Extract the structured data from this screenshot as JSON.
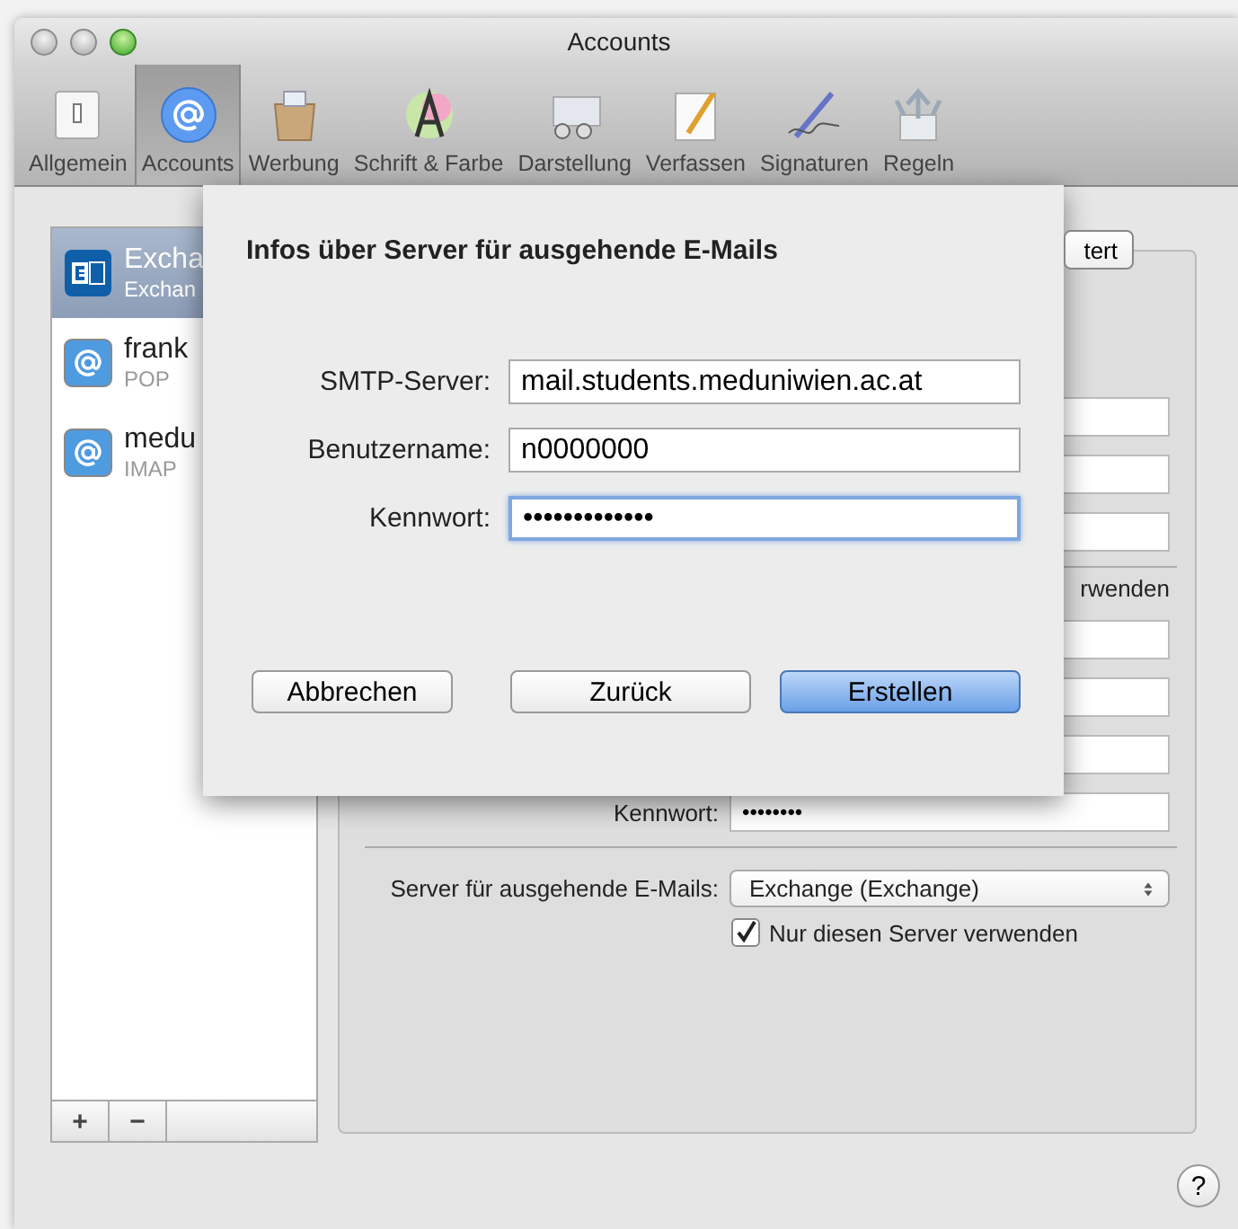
{
  "window": {
    "title": "Accounts"
  },
  "toolbar": [
    {
      "label": "Allgemein",
      "kind": "general",
      "selected": false
    },
    {
      "label": "Accounts",
      "kind": "at",
      "selected": true
    },
    {
      "label": "Werbung",
      "kind": "junk",
      "selected": false
    },
    {
      "label": "Schrift & Farbe",
      "kind": "font",
      "selected": false
    },
    {
      "label": "Darstellung",
      "kind": "view",
      "selected": false
    },
    {
      "label": "Verfassen",
      "kind": "compose",
      "selected": false
    },
    {
      "label": "Signaturen",
      "kind": "signature",
      "selected": false
    },
    {
      "label": "Regeln",
      "kind": "rules",
      "selected": false
    }
  ],
  "accounts": [
    {
      "name": "Excha",
      "type": "Exchan",
      "kind": "exchange",
      "selected": true
    },
    {
      "name": "frank",
      "type": "POP",
      "kind": "mail",
      "selected": false
    },
    {
      "name": "medu",
      "type": "IMAP",
      "kind": "mail",
      "selected": false
    }
  ],
  "list_buttons": [
    "+",
    "−"
  ],
  "panel": {
    "tab": "tert",
    "auto_detect_fragment": "rwenden",
    "password_label": "Kennwort:",
    "password_value": "••••••••",
    "outgoing_label": "Server für ausgehende E-Mails:",
    "outgoing_value": "Exchange (Exchange)",
    "only_this_server": {
      "label": "Nur diesen Server verwenden",
      "checked": true
    }
  },
  "sheet": {
    "title": "Infos über Server für ausgehende E-Mails",
    "fields": [
      {
        "label": "SMTP-Server:",
        "value": "mail.students.meduniwien.ac.at",
        "focused": false
      },
      {
        "label": "Benutzername:",
        "value": "n0000000",
        "focused": false
      },
      {
        "label": "Kennwort:",
        "value": "•••••••••••••",
        "focused": true
      }
    ],
    "buttons": [
      {
        "label": "Abbrechen",
        "default": false
      },
      {
        "label": "Zurück",
        "default": false
      },
      {
        "label": "Erstellen",
        "default": true
      }
    ]
  },
  "help": "?"
}
